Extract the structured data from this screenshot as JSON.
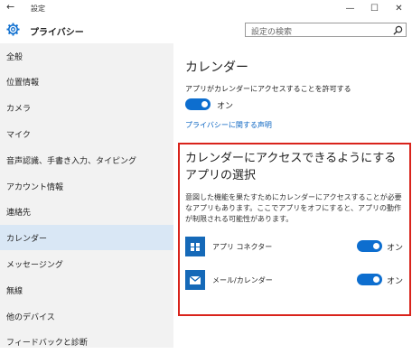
{
  "window": {
    "title": "設定",
    "back_glyph": "←",
    "minimize_glyph": "—",
    "maximize_glyph": "☐",
    "close_glyph": "✕"
  },
  "header": {
    "section_title": "プライバシー",
    "search_placeholder": "設定の検索"
  },
  "sidebar": {
    "items": [
      {
        "label": "全般"
      },
      {
        "label": "位置情報"
      },
      {
        "label": "カメラ"
      },
      {
        "label": "マイク"
      },
      {
        "label": "音声認識、手書き入力、タイピング"
      },
      {
        "label": "アカウント情報"
      },
      {
        "label": "連絡先"
      },
      {
        "label": "カレンダー"
      },
      {
        "label": "メッセージング"
      },
      {
        "label": "無線"
      },
      {
        "label": "他のデバイス"
      },
      {
        "label": "フィードバックと診断"
      }
    ],
    "selected_index": 7
  },
  "main": {
    "heading": "カレンダー",
    "allow_label": "アプリがカレンダーにアクセスすることを許可する",
    "allow_toggle_state": "オン",
    "privacy_link": "プライバシーに関する声明",
    "choose_heading": "カレンダーにアクセスできるようにするアプリの選択",
    "description": "意図した機能を果たすためにカレンダーにアクセスすることが必要なアプリもあります。ここでアプリをオフにすると、アプリの動作が制限される可能性があります。",
    "apps": [
      {
        "name": "アプリ コネクター",
        "state": "オン",
        "icon": "app-connector-icon"
      },
      {
        "name": "メール/カレンダー",
        "state": "オン",
        "icon": "mail-calendar-icon"
      }
    ]
  },
  "colors": {
    "accent": "#0d6ecf",
    "highlight_border": "#d9231b",
    "selected_nav": "#d9e7f5",
    "sidebar_bg": "#f2f2f2"
  }
}
